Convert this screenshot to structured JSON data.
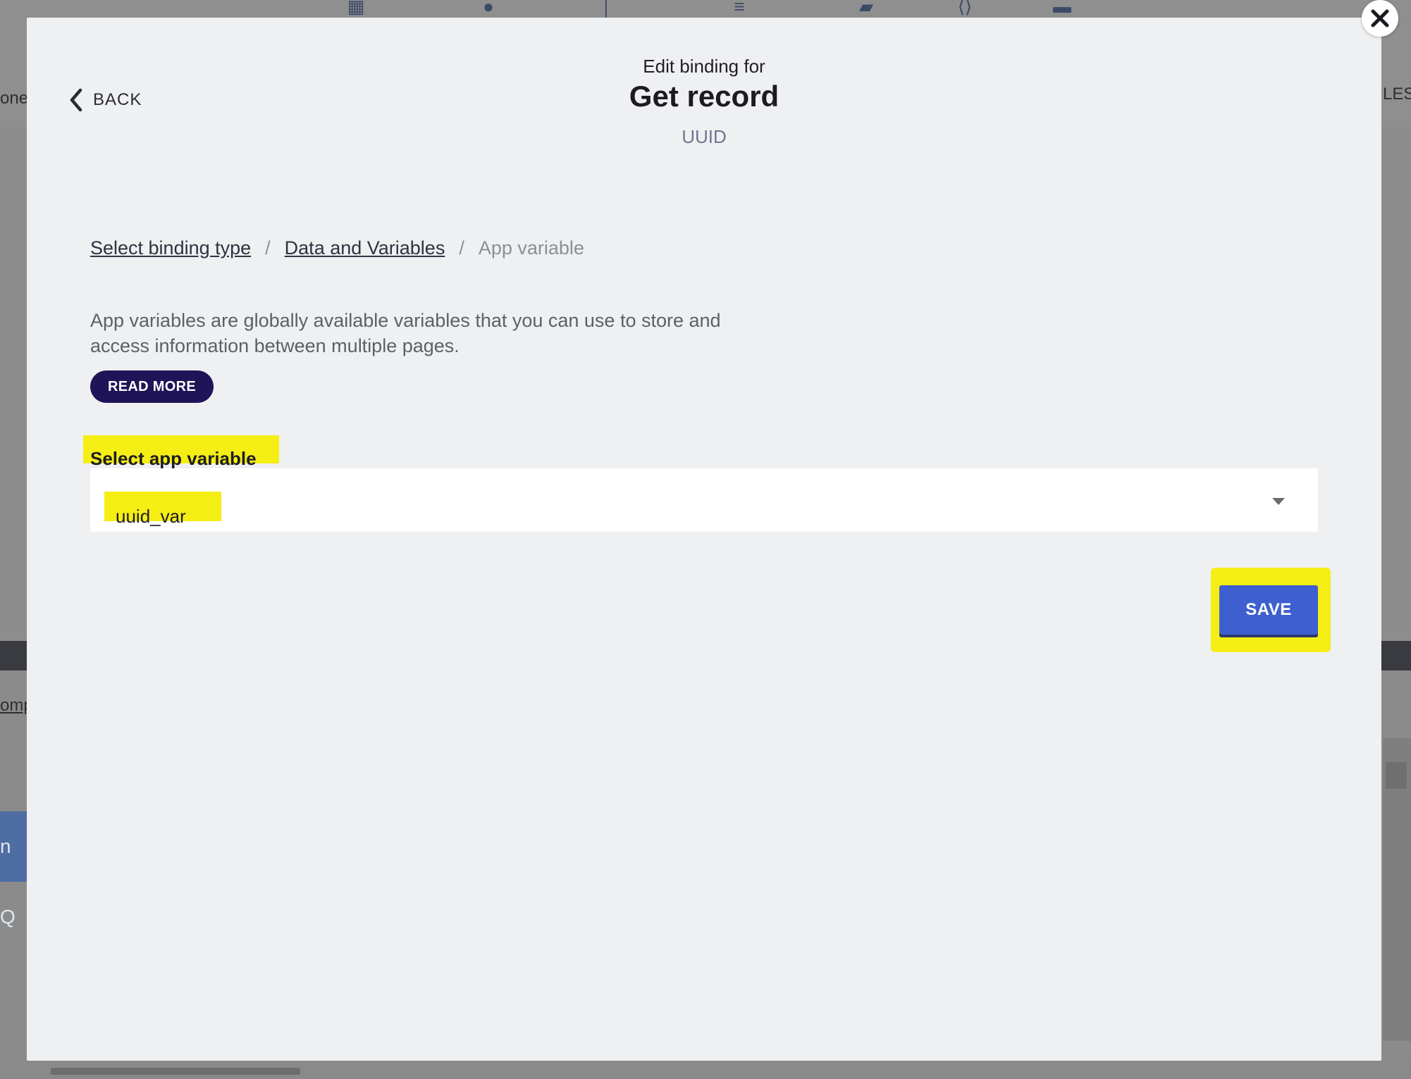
{
  "background": {
    "side_text_left": "one",
    "side_text_right": "LES",
    "side_link_left": "omp",
    "side_box_text": "n Q"
  },
  "modal": {
    "back_label": "BACK",
    "edit_for": "Edit binding for",
    "title": "Get record",
    "subtitle": "UUID",
    "breadcrumb": {
      "items": [
        {
          "label": "Select binding type"
        },
        {
          "label": "Data and Variables"
        },
        {
          "label": "App variable"
        }
      ],
      "separator": "/"
    },
    "description": "App variables are globally available variables that you can use to store and access information between multiple pages.",
    "read_more_label": "READ MORE",
    "field_label": "Select app variable",
    "select_value": "uuid_var",
    "save_label": "SAVE"
  },
  "colors": {
    "primary_button": "#3d5fd0",
    "read_more_button": "#1f1458",
    "highlight": "#f5ee15"
  },
  "icons": [
    "back-chevron-icon",
    "close-icon",
    "dropdown-arrow-icon"
  ]
}
